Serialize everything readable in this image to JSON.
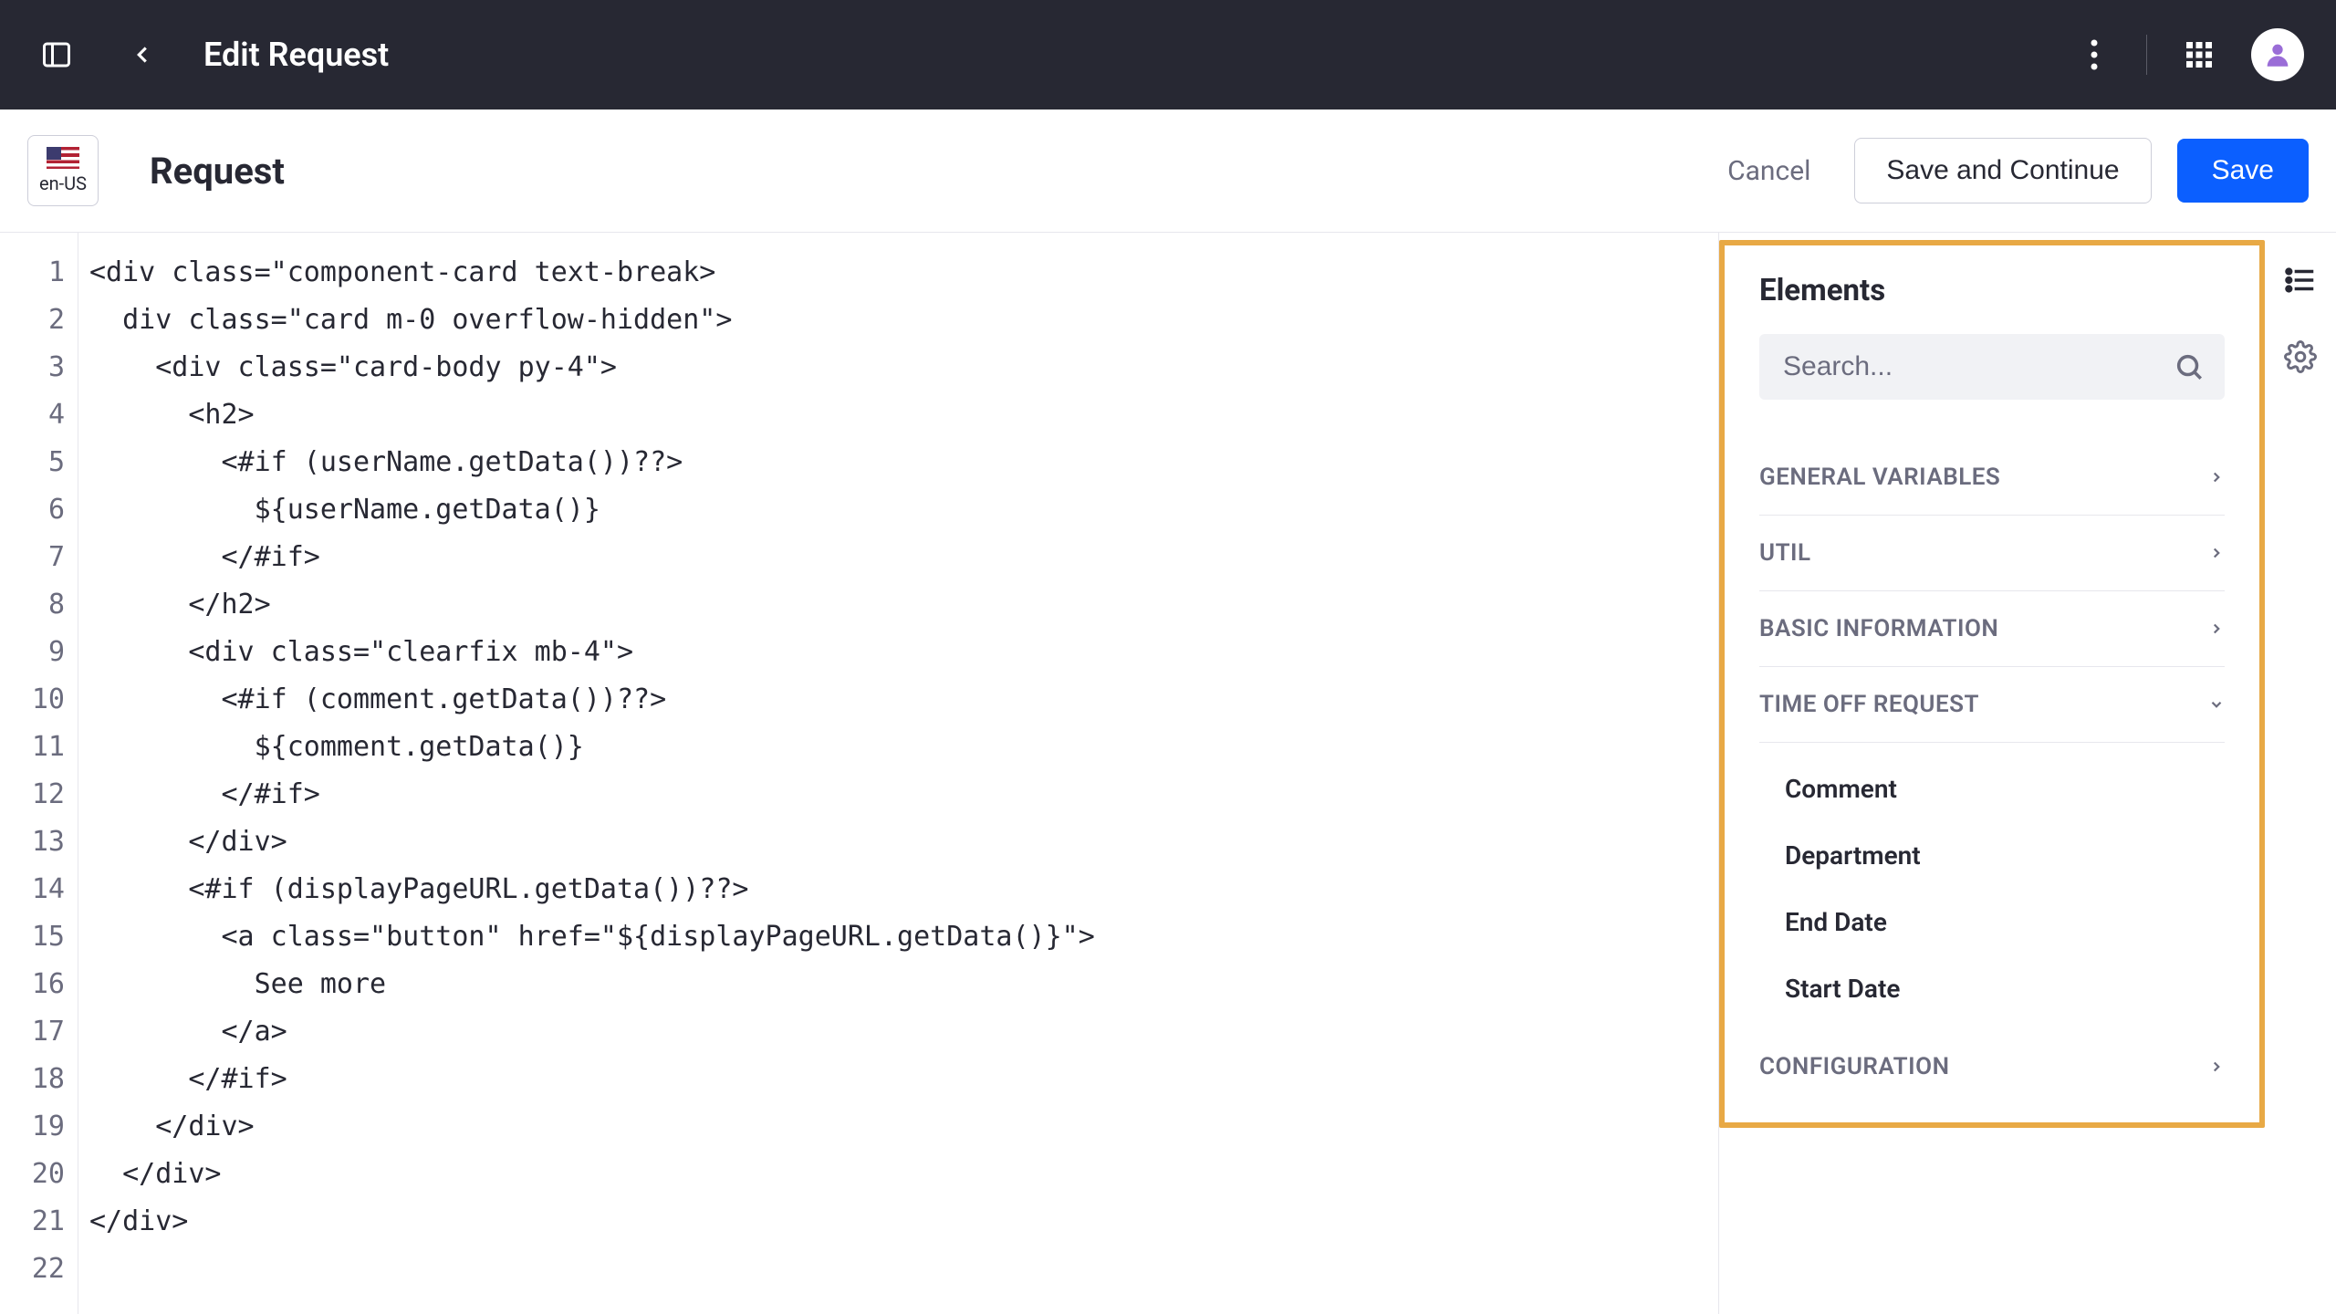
{
  "topbar": {
    "title": "Edit Request"
  },
  "subheader": {
    "locale": "en-US",
    "title": "Request",
    "cancel": "Cancel",
    "save_continue": "Save and Continue",
    "save": "Save"
  },
  "editor": {
    "lines": [
      "<div class=\"component-card text-break>",
      "  div class=\"card m-0 overflow-hidden\">",
      "    <div class=\"card-body py-4\">",
      "      <h2>",
      "        <#if (userName.getData())??>",
      "          ${userName.getData()}",
      "        </#if>",
      "      </h2>",
      "",
      "      <div class=\"clearfix mb-4\">",
      "        <#if (comment.getData())??>",
      "          ${comment.getData()}",
      "        </#if>",
      "      </div>",
      "      <#if (displayPageURL.getData())??>",
      "        <a class=\"button\" href=\"${displayPageURL.getData()}\">",
      "          See more",
      "        </a>",
      "      </#if>",
      "    </div>",
      "  </div>",
      "</div>"
    ]
  },
  "elements": {
    "title": "Elements",
    "search_placeholder": "Search...",
    "categories": {
      "general": "GENERAL VARIABLES",
      "util": "UTIL",
      "basic": "BASIC INFORMATION",
      "timeoff": "TIME OFF REQUEST",
      "config": "CONFIGURATION"
    },
    "timeoff_items": {
      "comment": "Comment",
      "department": "Department",
      "end_date": "End Date",
      "start_date": "Start Date"
    }
  }
}
